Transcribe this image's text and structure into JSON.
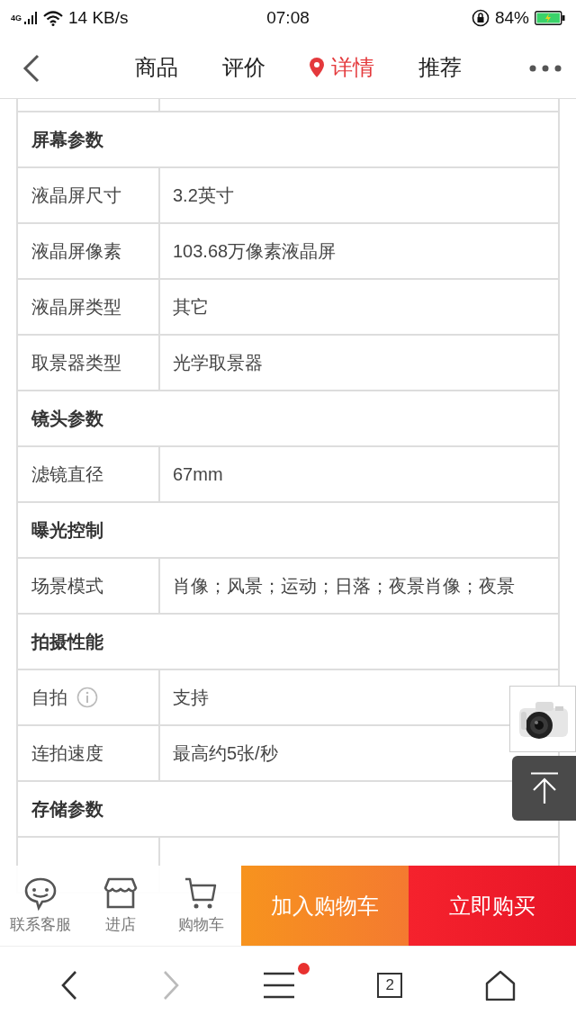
{
  "status_bar": {
    "network": "4G",
    "speed": "14 KB/s",
    "time": "07:08",
    "battery": "84%"
  },
  "nav": {
    "tabs": [
      {
        "label": "商品",
        "selected": false
      },
      {
        "label": "评价",
        "selected": false
      },
      {
        "label": "详情",
        "selected": true
      },
      {
        "label": "推荐",
        "selected": false
      }
    ]
  },
  "spec_table": {
    "rows": [
      {
        "kind": "blank"
      },
      {
        "kind": "section",
        "label": "屏幕参数"
      },
      {
        "kind": "param",
        "label": "液晶屏尺寸",
        "value": "3.2英寸"
      },
      {
        "kind": "param",
        "label": "液晶屏像素",
        "value": "103.68万像素液晶屏"
      },
      {
        "kind": "param",
        "label": "液晶屏类型",
        "value": "其它"
      },
      {
        "kind": "param",
        "label": "取景器类型",
        "value": "光学取景器"
      },
      {
        "kind": "section",
        "label": "镜头参数"
      },
      {
        "kind": "param",
        "label": "滤镜直径",
        "value": "67mm"
      },
      {
        "kind": "section",
        "label": "曝光控制"
      },
      {
        "kind": "param",
        "label": "场景模式",
        "value": "肖像；风景；运动；日落；夜景肖像；夜景"
      },
      {
        "kind": "section",
        "label": "拍摄性能"
      },
      {
        "kind": "param",
        "label": "自拍",
        "value": "支持",
        "info": true
      },
      {
        "kind": "param",
        "label": "连拍速度",
        "value": "最高约5张/秒"
      },
      {
        "kind": "section",
        "label": "存储参数"
      },
      {
        "kind": "blank"
      }
    ]
  },
  "action_bar": {
    "links": [
      {
        "kind": "service",
        "label": "联系客服"
      },
      {
        "kind": "store",
        "label": "进店"
      },
      {
        "kind": "cart",
        "label": "购物车"
      }
    ],
    "buttons": [
      {
        "kind": "add",
        "label": "加入购物车"
      },
      {
        "kind": "buy",
        "label": "立即购买"
      }
    ]
  },
  "browser_bar": {
    "forward_disabled": true,
    "menu_notification": true,
    "tab_count": "2"
  }
}
